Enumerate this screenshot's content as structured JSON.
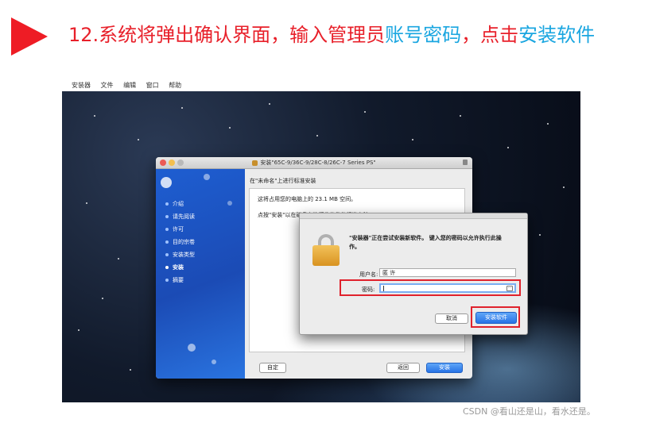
{
  "slide": {
    "title_red": "12.系统将弹出确认界面，输入管理员",
    "title_blue_1": "账号密码",
    "title_red_2": "，点击",
    "title_blue_2": "安装软件",
    "watermark": "CSDN @看山还是山，看水还是。"
  },
  "menubar": {
    "items": [
      "安装器",
      "文件",
      "编辑",
      "窗口",
      "帮助"
    ]
  },
  "installer": {
    "window_title": "安装\"65C-9/36C-9/28C-8/26C-7 Series PS\"",
    "heading": "在\"未命名\"上进行标准安装",
    "line1": "这将占用您的电脑上的 23.1 MB 空间。",
    "line2": "点按\"安装\"以在磁盘上执行此软件的标准安装。",
    "steps": [
      "介绍",
      "请先阅读",
      "许可",
      "目的宗卷",
      "安装类型",
      "安装",
      "摘要"
    ],
    "custom_button": "自定",
    "back_button": "返回",
    "install_button": "安装"
  },
  "auth_dialog": {
    "message": "\"安装器\"正在尝试安装新软件。 键入您的密码以允许执行此操作。",
    "username_label": "用户名:",
    "username_value": "匿 许",
    "password_label": "密码:",
    "cancel_button": "取消",
    "install_software_button": "安装软件"
  },
  "colors": {
    "title_red": "#e8202a",
    "title_blue": "#1aa6e0",
    "highlight_red": "#e0222c",
    "accent_blue": "#2873e6"
  }
}
